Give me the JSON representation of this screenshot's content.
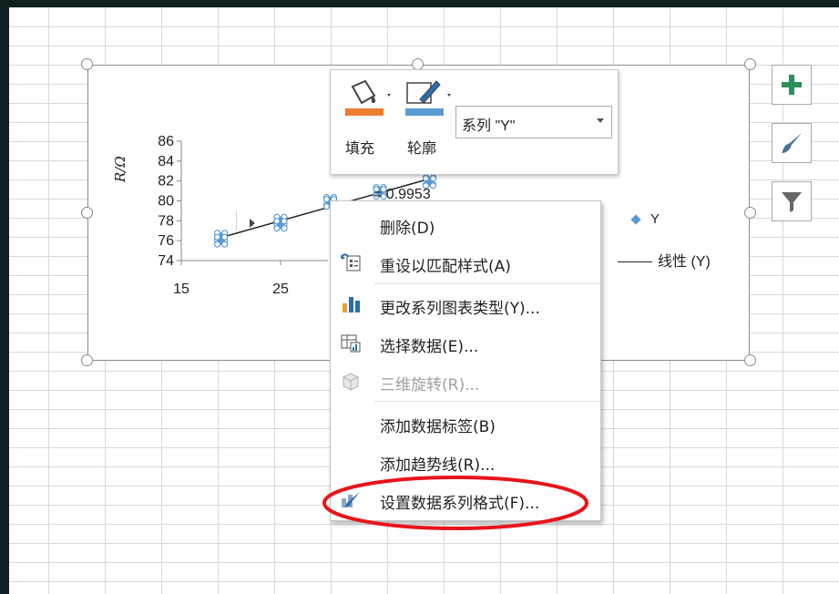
{
  "chart": {
    "y_axis_label": "R/Ω",
    "y_ticks": [
      "86",
      "84",
      "82",
      "80",
      "78",
      "76",
      "74"
    ],
    "x_ticks": [
      "15",
      "25"
    ],
    "r_squared": "= 0.9953",
    "legend_series": "Y",
    "legend_trendline": "线性 (Y)"
  },
  "chart_data": {
    "type": "scatter",
    "series": [
      {
        "name": "Y",
        "x": [
          19,
          19,
          25,
          25,
          30,
          30,
          35,
          35,
          40,
          40
        ],
        "y": [
          76.4,
          76.0,
          78.0,
          77.6,
          80.0,
          79.8,
          81.0,
          80.8,
          82.0,
          81.9
        ]
      }
    ],
    "trendline": "linear",
    "r_squared": "0.9953",
    "xlim": [
      15,
      45
    ],
    "ylim": [
      74,
      86
    ],
    "ylabel": "R/Ω",
    "colors": {
      "marker": "#5b9bd5",
      "trendline": "#222222"
    }
  },
  "mini_toolbar": {
    "fill_label": "填充",
    "outline_label": "轮廓",
    "series_selected": "系列 \"Y\"",
    "fill_color": "#ed7d31",
    "outline_color": "#5b9bd5"
  },
  "side_buttons": [
    "add-element-icon",
    "brush-icon",
    "filter-icon"
  ],
  "context_menu": {
    "items": [
      {
        "label": "删除(D)",
        "icon": "",
        "enabled": true
      },
      {
        "label": "重设以匹配样式(A)",
        "icon": "reset-style-icon",
        "enabled": true
      },
      {
        "label": "更改系列图表类型(Y)...",
        "icon": "chart-type-icon",
        "enabled": true
      },
      {
        "label": "选择数据(E)...",
        "icon": "select-data-icon",
        "enabled": true
      },
      {
        "label": "三维旋转(R)...",
        "icon": "rotate-3d-icon",
        "enabled": false
      },
      {
        "label": "添加数据标签(B)",
        "icon": "",
        "enabled": true
      },
      {
        "label": "添加趋势线(R)...",
        "icon": "",
        "enabled": true
      },
      {
        "label": "设置数据系列格式(F)...",
        "icon": "format-series-icon",
        "enabled": true
      }
    ]
  },
  "annotation_color": "#e8141b"
}
